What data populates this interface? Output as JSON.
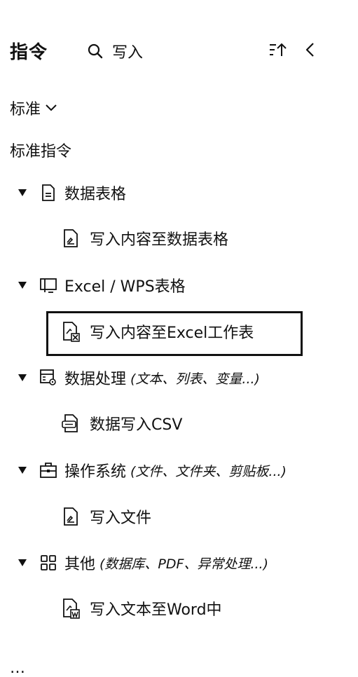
{
  "header": {
    "title": "指令",
    "search_text": "写入"
  },
  "filter": {
    "label": "标准"
  },
  "section": {
    "label": "标准指令"
  },
  "categories": [
    {
      "label": "数据表格",
      "hint": "",
      "icon": "document-icon",
      "items": [
        {
          "label": "写入内容至数据表格",
          "icon": "doc-edit-icon"
        }
      ]
    },
    {
      "label": "Excel / WPS表格",
      "hint": "",
      "icon": "monitor-icon",
      "items": [
        {
          "label": "写入内容至Excel工作表",
          "icon": "excel-file-icon"
        }
      ]
    },
    {
      "label": "数据处理",
      "hint": "(文本、列表、变量...)",
      "icon": "data-process-icon",
      "items": [
        {
          "label": "数据写入CSV",
          "icon": "csv-file-icon"
        }
      ]
    },
    {
      "label": "操作系统",
      "hint": "(文件、文件夹、剪贴板...)",
      "icon": "briefcase-icon",
      "items": [
        {
          "label": "写入文件",
          "icon": "doc-edit-icon"
        }
      ]
    },
    {
      "label": "其他",
      "hint": "(数据库、PDF、异常处理...)",
      "icon": "grid-icon",
      "items": [
        {
          "label": "写入文本至Word中",
          "icon": "word-file-icon"
        }
      ]
    }
  ],
  "footer_peek": "…"
}
